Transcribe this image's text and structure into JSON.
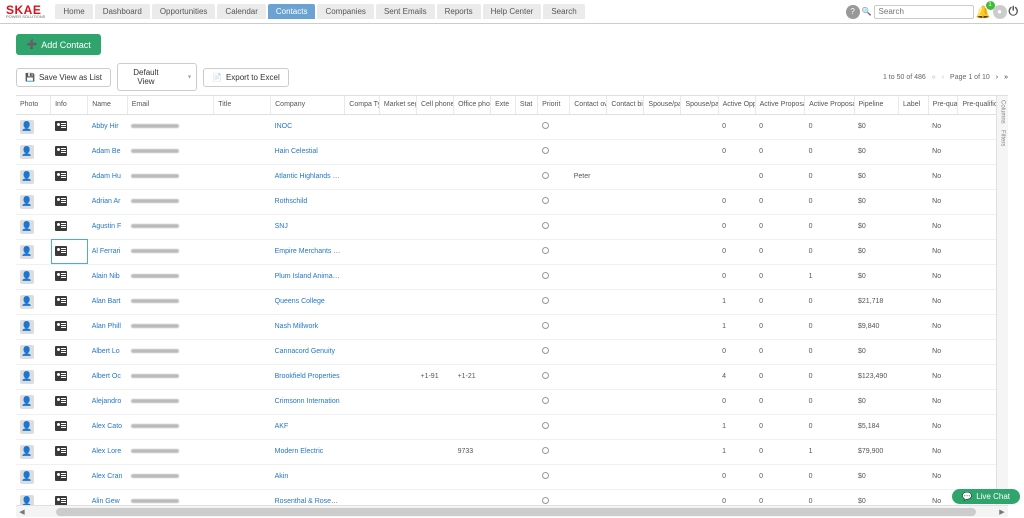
{
  "brand": {
    "main": "SKAE",
    "sub": "POWER SOLUTIONS"
  },
  "nav": {
    "items": [
      "Home",
      "Dashboard",
      "Opportunities",
      "Calendar",
      "Contacts",
      "Companies",
      "Sent Emails",
      "Reports",
      "Help Center",
      "Search"
    ],
    "activeIndex": 4
  },
  "search": {
    "placeholder": "Search"
  },
  "bell": {
    "badge": "1"
  },
  "toolbar": {
    "add": "Add Contact",
    "savelist": "Save View as List",
    "view": "Default View",
    "export": "Export to Excel"
  },
  "paging": {
    "range": "1 to 50 of 486",
    "page": "Page 1 of 10"
  },
  "chat": "Live Chat",
  "sidetabs": [
    "Columns",
    "Filters"
  ],
  "columns": [
    "Photo",
    "Info",
    "Name",
    "Email",
    "Title",
    "Company",
    "Compa Type",
    "Market segment",
    "Cell phone",
    "Office phone",
    "Exte",
    "Stat",
    "Priorit",
    "Contact owner",
    "Contact birthday",
    "Spouse/partner name",
    "Spouse/partner birthday",
    "Active Opportuni",
    "Active Proposals for Contact",
    "Active Proposals for Company",
    "Pipeline",
    "Label",
    "Pre-qualified",
    "Pre-qualification Exp Date"
  ],
  "rows": [
    {
      "name": "Abby Hir",
      "company": "INOC",
      "aop": "0",
      "apc": "0",
      "apco": "0",
      "pipe": "$0",
      "preq": "No"
    },
    {
      "name": "Adam Be",
      "company": "Hain Celestial",
      "aop": "0",
      "apc": "0",
      "apco": "0",
      "pipe": "$0",
      "preq": "No"
    },
    {
      "name": "Adam Hu",
      "company": "Atlantic Highlands PD",
      "cown": "Peter",
      "apc": "0",
      "apco": "0",
      "pipe": "$0",
      "preq": "No"
    },
    {
      "name": "Adrian Ar",
      "company": "Rothschild",
      "aop": "0",
      "apc": "0",
      "apco": "0",
      "pipe": "$0",
      "preq": "No"
    },
    {
      "name": "Agustin F",
      "company": "SNJ",
      "aop": "0",
      "apc": "0",
      "apco": "0",
      "pipe": "$0",
      "preq": "No"
    },
    {
      "name": "Al Ferrari",
      "company": "Empire Merchants Nor",
      "aop": "0",
      "apc": "0",
      "apco": "0",
      "pipe": "$0",
      "preq": "No",
      "selected": true
    },
    {
      "name": "Alain Nib",
      "company": "Plum Island Animal Di",
      "aop": "0",
      "apc": "0",
      "apco": "1",
      "pipe": "$0",
      "preq": "No"
    },
    {
      "name": "Alan Bart",
      "company": "Queens College",
      "aop": "1",
      "apc": "0",
      "apco": "0",
      "pipe": "$21,718",
      "preq": "No"
    },
    {
      "name": "Alan Phill",
      "company": "Nash Millwork",
      "aop": "1",
      "apc": "0",
      "apco": "0",
      "pipe": "$9,840",
      "preq": "No"
    },
    {
      "name": "Albert Lo",
      "company": "Cannacord Genuity",
      "aop": "0",
      "apc": "0",
      "apco": "0",
      "pipe": "$0",
      "preq": "No"
    },
    {
      "name": "Albert Oc",
      "company": "Brookfield Properties",
      "cell": "+1-91",
      "office": "+1-21",
      "aop": "4",
      "apc": "0",
      "apco": "0",
      "pipe": "$123,490",
      "preq": "No"
    },
    {
      "name": "Alejandro",
      "company": "Crimsonn Internation",
      "aop": "0",
      "apc": "0",
      "apco": "0",
      "pipe": "$0",
      "preq": "No"
    },
    {
      "name": "Alex Cato",
      "company": "AKF",
      "aop": "1",
      "apc": "0",
      "apco": "0",
      "pipe": "$5,184",
      "preq": "No"
    },
    {
      "name": "Alex Lore",
      "company": "Modern Electric",
      "office": "9733",
      "aop": "1",
      "apc": "0",
      "apco": "1",
      "pipe": "$79,900",
      "preq": "No"
    },
    {
      "name": "Alex Cran",
      "company": "Akin",
      "aop": "0",
      "apc": "0",
      "apco": "0",
      "pipe": "$0",
      "preq": "No"
    },
    {
      "name": "Alin Gew",
      "company": "Rosenthal & Rosenthal",
      "aop": "0",
      "apc": "0",
      "apco": "0",
      "pipe": "$0",
      "preq": "No"
    }
  ]
}
